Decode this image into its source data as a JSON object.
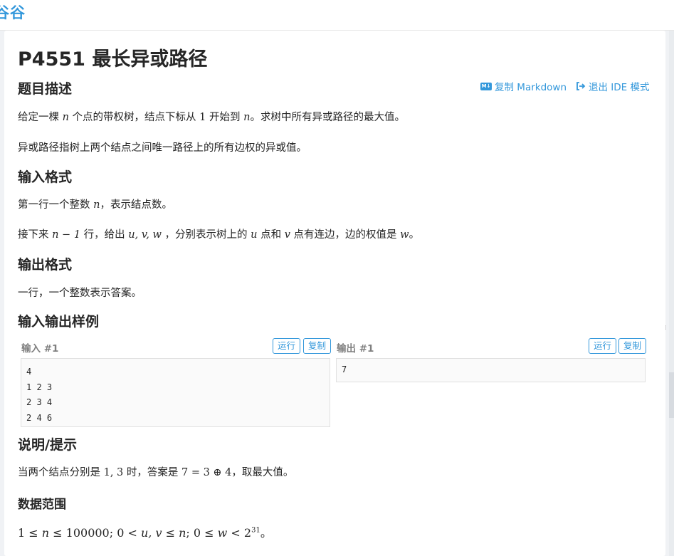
{
  "header": {
    "logo_text": "谷谷"
  },
  "problem": {
    "title": "P4551 最长异或路径"
  },
  "toolbar": {
    "copy_markdown": "复制 Markdown",
    "exit_ide": "退出 IDE 模式",
    "md_icon_text": "M↓"
  },
  "sections": {
    "description_heading": "题目描述",
    "description_p1": {
      "a": "给定一棵 ",
      "n": "n",
      "b": " 个点的带权树，结点下标从 ",
      "one": "1",
      "c": " 开始到 ",
      "n2": "n",
      "d": "。求树中所有异或路径的最大值。"
    },
    "description_p2": "异或路径指树上两个结点之间唯一路径上的所有边权的异或值。",
    "input_heading": "输入格式",
    "input_p1": {
      "a": "第一行一个整数 ",
      "n": "n",
      "b": "，表示结点数。"
    },
    "input_p2": {
      "a": "接下来 ",
      "expr": "n − 1",
      "b": " 行，给出 ",
      "vars": "u, v, w",
      "c": " ，分别表示树上的 ",
      "u": "u",
      "d": " 点和 ",
      "v": "v",
      "e": " 点有连边，边的权值是 ",
      "w": "w",
      "f": "。"
    },
    "output_heading": "输出格式",
    "output_p1": "一行，一个整数表示答案。",
    "samples_heading": "输入输出样例",
    "hint_heading": "说明/提示",
    "hint_p1": {
      "a": "当两个结点分别是 ",
      "nums": "1, 3",
      "b": " 时，答案是 ",
      "expr": "7 = 3 ⊕ 4",
      "c": "，取最大值。"
    },
    "range_heading": "数据范围",
    "range_p1": {
      "a": "1 ≤ ",
      "n": "n",
      "b": " ≤ 100000; 0 < ",
      "uv": "u, v",
      "c": " ≤ ",
      "n2": "n",
      "d": "; 0 ≤ ",
      "w": "w",
      "e": " < 2",
      "exp": "31",
      "f": "。"
    }
  },
  "samples": {
    "input_label": "输入 #1",
    "output_label": "输出 #1",
    "run_label": "运行",
    "copy_label": "复制",
    "input_text": "4\n1 2 3\n2 3 4\n2 4 6",
    "output_text": "7"
  },
  "colors": {
    "accent": "#3498db",
    "text": "#262626",
    "muted": "#7f7f7f",
    "page_bg": "#f0f2f5"
  }
}
